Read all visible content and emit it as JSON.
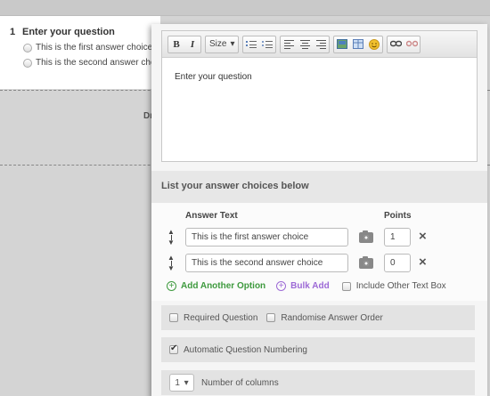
{
  "background": {
    "question_number": "1",
    "question_title": "Enter your question",
    "options": [
      "This is the first answer choice",
      "This is the second answer choice"
    ],
    "truncated_text": "Dr"
  },
  "editor": {
    "toolbar": {
      "bold": "B",
      "italic": "I",
      "size_label": "Size",
      "size_caret": "▾"
    },
    "content": "Enter your question"
  },
  "answers": {
    "section_title": "List your answer choices below",
    "col_answer": "Answer Text",
    "col_points": "Points",
    "rows": [
      {
        "text": "This is the first answer choice",
        "points": "1"
      },
      {
        "text": "This is the second answer choice",
        "points": "0"
      }
    ],
    "add_option": "Add Another Option",
    "bulk_add": "Bulk Add",
    "include_other": "Include Other Text Box"
  },
  "settings": {
    "required": "Required Question",
    "randomise": "Randomise Answer Order",
    "auto_numbering": "Automatic Question Numbering",
    "columns_value": "1",
    "columns_label": "Number of columns"
  }
}
